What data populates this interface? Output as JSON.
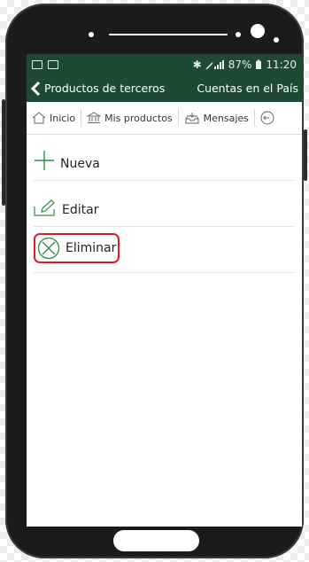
{
  "status": {
    "bluetooth": "✱",
    "battery": "87%",
    "time": "11:20"
  },
  "appbar": {
    "back_label": "Productos de terceros",
    "right_label": "Cuentas en el País"
  },
  "toolbar": {
    "items": [
      {
        "label": "Inicio",
        "icon": "home-icon"
      },
      {
        "label": "Mis productos",
        "icon": "bank-icon"
      },
      {
        "label": "Mensajes",
        "icon": "inbox-icon"
      }
    ]
  },
  "actions": [
    {
      "label": "Nueva",
      "icon": "plus-icon"
    },
    {
      "label": "Editar",
      "icon": "edit-icon"
    },
    {
      "label": "Eliminar",
      "icon": "delete-circle-icon"
    }
  ],
  "colors": {
    "brand_green": "#1e4a33",
    "accent_green": "#2f8a4a",
    "highlight_red": "#d91f2e"
  }
}
